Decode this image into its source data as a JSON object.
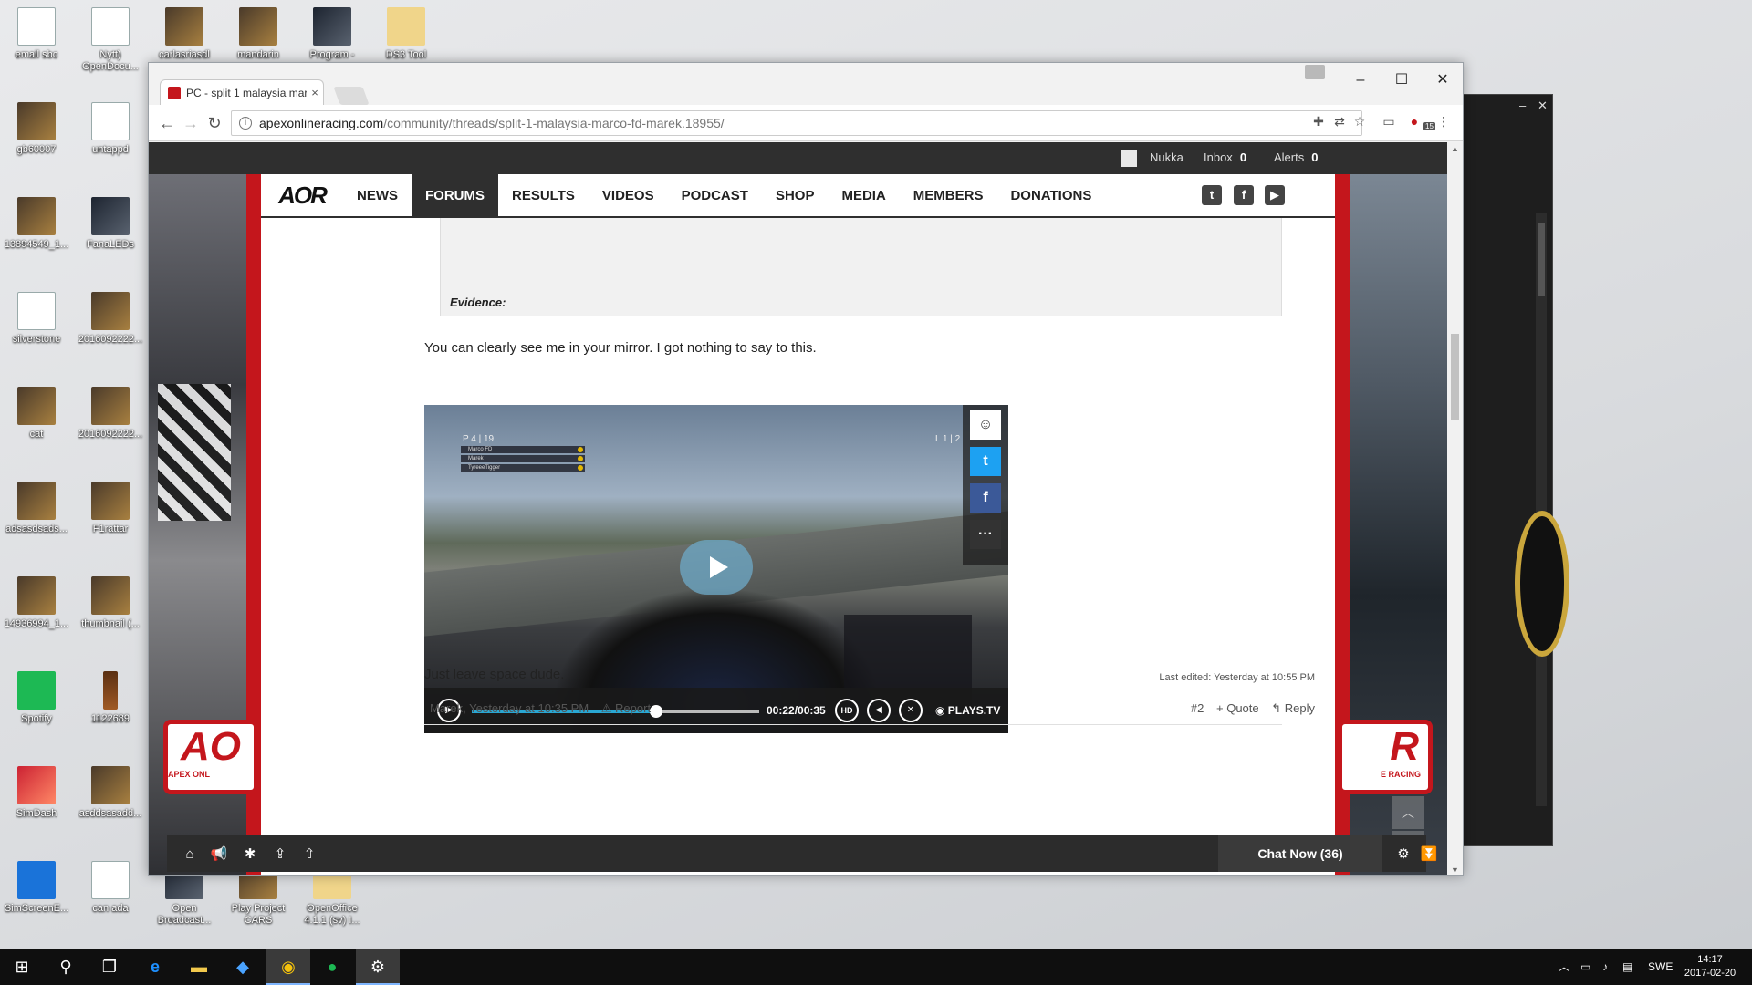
{
  "desktop": {
    "icons": [
      {
        "label": "email sbc",
        "icon": "document-icon"
      },
      {
        "label": "Nytt) OpenDocu...",
        "icon": "document-icon"
      },
      {
        "label": "carlasriasdl",
        "icon": "image-icon"
      },
      {
        "label": "mandarin",
        "icon": "image-icon"
      },
      {
        "label": "Program -",
        "icon": "program-icon"
      },
      {
        "label": "DS3 Tool",
        "icon": "folder-icon"
      },
      {
        "label": "gb60007",
        "icon": "image-icon"
      },
      {
        "label": "untappd",
        "icon": "document-icon"
      },
      {
        "label": "13894549_1...",
        "icon": "image-icon"
      },
      {
        "label": "FanaLEDs",
        "icon": "app-icon"
      },
      {
        "label": "silverstone",
        "icon": "document-icon"
      },
      {
        "label": "2016092222...",
        "icon": "image-icon"
      },
      {
        "label": "cat",
        "icon": "image-icon"
      },
      {
        "label": "2016092222...",
        "icon": "image-icon"
      },
      {
        "label": "adsasdsads...",
        "icon": "image-icon"
      },
      {
        "label": "F1rattar",
        "icon": "archive-icon"
      },
      {
        "label": "14936994_1...",
        "icon": "image-icon"
      },
      {
        "label": "thumbnail (...",
        "icon": "image-icon"
      },
      {
        "label": "Spotify",
        "icon": "spotify-icon"
      },
      {
        "label": "1122689",
        "icon": "bottle-icon"
      },
      {
        "label": "SimDash",
        "icon": "gauge-icon"
      },
      {
        "label": "asddsasadd...",
        "icon": "image-icon"
      },
      {
        "label": "SimScreenE...",
        "icon": "monitor-icon"
      },
      {
        "label": "can ada",
        "icon": "document-icon"
      },
      {
        "label": "Open Broadcast...",
        "icon": "obs-icon"
      },
      {
        "label": "Play Project CARS",
        "icon": "game-icon"
      },
      {
        "label": "OpenOffice 4.1.1 (sv) I...",
        "icon": "folder-icon"
      }
    ]
  },
  "browser": {
    "tab_title": "PC - split 1 malaysia mar",
    "tab_close": "×",
    "url_host": "apexonlineracing.com",
    "url_path": "/community/threads/split-1-malaysia-marco-fd-marek.18955/",
    "ext_badge": "15",
    "win_min": "–",
    "win_max": "☐",
    "win_close": "✕"
  },
  "site": {
    "userbar": {
      "username": "Nukka",
      "inbox_label": "Inbox",
      "inbox_count": "0",
      "alerts_label": "Alerts",
      "alerts_count": "0"
    },
    "logo": "AOR",
    "nav": [
      "NEWS",
      "FORUMS",
      "RESULTS",
      "VIDEOS",
      "PODCAST",
      "SHOP",
      "MEDIA",
      "MEMBERS",
      "DONATIONS"
    ],
    "active_nav": "FORUMS",
    "social": {
      "twitter": "t",
      "facebook": "f",
      "youtube": "▶"
    },
    "banner_left": {
      "big": "AO",
      "small": "APEX ONL"
    },
    "banner_right": {
      "big": "R",
      "small": "E RACING"
    }
  },
  "post": {
    "evidence_label": "Evidence:",
    "message_1": "You can clearly see me in your mirror. I got nothing to say to this.",
    "message_2": "Just leave space dude.",
    "last_edited": "Last edited: Yesterday at 10:55 PM",
    "author_time": "Marek, Yesterday at 10:35 PM",
    "report": "⚠ Report",
    "post_number": "#2",
    "quote": "+ Quote",
    "reply": "↰ Reply"
  },
  "video": {
    "corner_left": "P 4 | 19",
    "corner_right": "L 1 | 2",
    "leaderboard": [
      "Marco FD",
      "Marek",
      "TyreeeTigger"
    ],
    "time": "00:22/00:35",
    "progress": 0.64,
    "hd_label": "HD",
    "brand": "◉ PLAYS.TV",
    "share": {
      "reddit": "☺",
      "twitter": "t",
      "facebook": "f",
      "more": "···"
    }
  },
  "site_toolbar": {
    "chat_label": "Chat Now (36)"
  },
  "taskbar": {
    "language": "SWE",
    "time": "14:17",
    "date": "2017-02-20"
  }
}
